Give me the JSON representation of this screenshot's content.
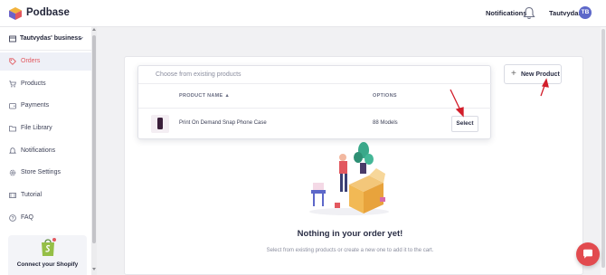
{
  "header": {
    "brand": "Podbase",
    "notifications_label": "Notifications",
    "username": "Tautvydas",
    "avatar_initials": "TB",
    "avatar_color": "#5d68c9"
  },
  "sidebar": {
    "business": "Tautvydas' business",
    "items": [
      {
        "label": "Orders",
        "icon": "tag-icon",
        "active": true
      },
      {
        "label": "Products",
        "icon": "cart-icon"
      },
      {
        "label": "Payments",
        "icon": "wallet-icon"
      },
      {
        "label": "File Library",
        "icon": "folder-icon"
      },
      {
        "label": "Notifications",
        "icon": "bell-icon"
      },
      {
        "label": "Store Settings",
        "icon": "gear-icon"
      },
      {
        "label": "Tutorial",
        "icon": "video-icon"
      },
      {
        "label": "FAQ",
        "icon": "help-icon"
      }
    ],
    "shopify_text": "Connect your Shopify"
  },
  "main": {
    "new_product_label": "New Product",
    "dropdown": {
      "placeholder": "Choose from existing products",
      "col_product_name": "PRODUCT NAME",
      "col_options": "OPTIONS",
      "rows": [
        {
          "name": "Print On Demand Snap Phone Case",
          "options": "88 Models",
          "action": "Select"
        }
      ]
    },
    "empty_title": "Nothing in your order yet!",
    "empty_subtitle": "Select from existing products or create a new one to add it to the cart."
  },
  "colors": {
    "accent": "#e2585f",
    "annotation_arrow": "#d21e2b",
    "chat_bubble": "#e24b4f"
  }
}
